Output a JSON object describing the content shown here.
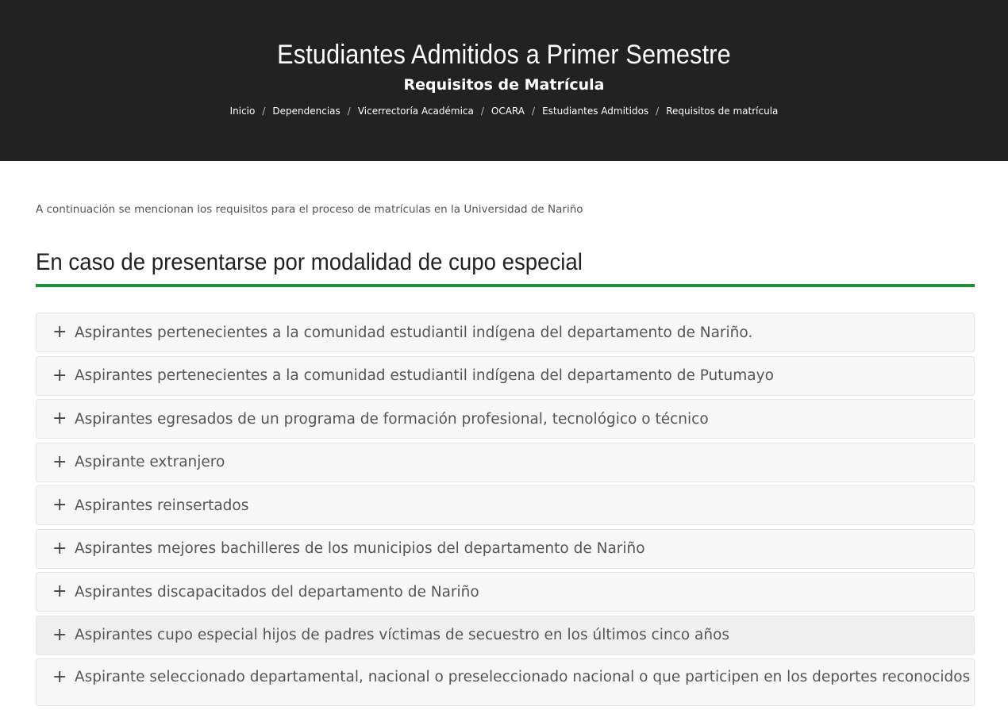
{
  "header": {
    "title": "Estudiantes Admitidos a Primer Semestre",
    "subtitle": "Requisitos de Matrícula",
    "breadcrumb": [
      "Inicio",
      "Dependencias",
      "Vicerrectoría Académica",
      "OCARA",
      "Estudiantes Admitidos",
      "Requisitos de matrícula"
    ],
    "breadcrumb_separator": "/"
  },
  "main": {
    "intro": "A continuación se mencionan los requisitos para el proceso de matrículas en la Universidad de Nariño",
    "section_title": "En caso de presentarse por modalidad de cupo especial",
    "accordion_icon": "+",
    "accordion": [
      "Aspirantes pertenecientes a la comunidad estudiantil indígena del departamento de Nariño.",
      "Aspirantes pertenecientes a la comunidad estudiantil indígena del departamento de Putumayo",
      "Aspirantes egresados de un programa de formación profesional, tecnológico o técnico",
      "Aspirante extranjero",
      "Aspirantes reinsertados",
      "Aspirantes mejores bachilleres de los municipios del departamento de Nariño",
      "Aspirantes discapacitados del departamento de Nariño",
      "Aspirantes cupo especial hijos de padres víctimas de secuestro en los últimos cinco años",
      "Aspirante seleccionado departamental, nacional o preseleccionado nacional o que participen en los deportes reconocidos por el"
    ]
  },
  "colors": {
    "hero_bg": "#222222",
    "accent_green": "#1f8f3a",
    "accordion_bg": "#f7f7f7"
  }
}
